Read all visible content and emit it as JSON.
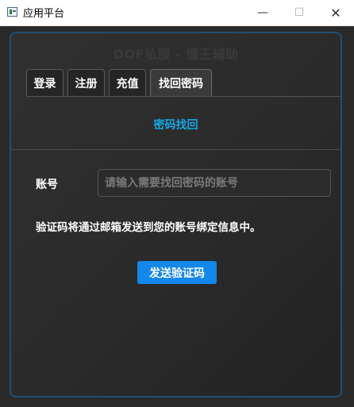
{
  "window": {
    "title": "应用平台",
    "minimize_glyph": "—",
    "maximize_glyph": "☐",
    "close_glyph": "✕"
  },
  "app": {
    "heading": "DOF私服 - 懂王辅助"
  },
  "tabs": [
    {
      "label": "登录",
      "active": false
    },
    {
      "label": "注册",
      "active": false
    },
    {
      "label": "充值",
      "active": false
    },
    {
      "label": "找回密码",
      "active": true
    }
  ],
  "recover": {
    "section_title": "密码找回",
    "account_label": "账号",
    "account_value": "",
    "account_placeholder": "请输入需要找回密码的账号",
    "info_text": "验证码将通过邮箱发送到您的账号绑定信息中。",
    "send_button": "发送验证码"
  },
  "colors": {
    "accent": "#16a8e6",
    "button": "#1487ea",
    "background": "#2a2a2a",
    "panel_border": "#1f4f73"
  },
  "icons": {
    "app": "app-window-icon",
    "minimize": "minimize-icon",
    "maximize": "maximize-icon",
    "close": "close-icon"
  }
}
